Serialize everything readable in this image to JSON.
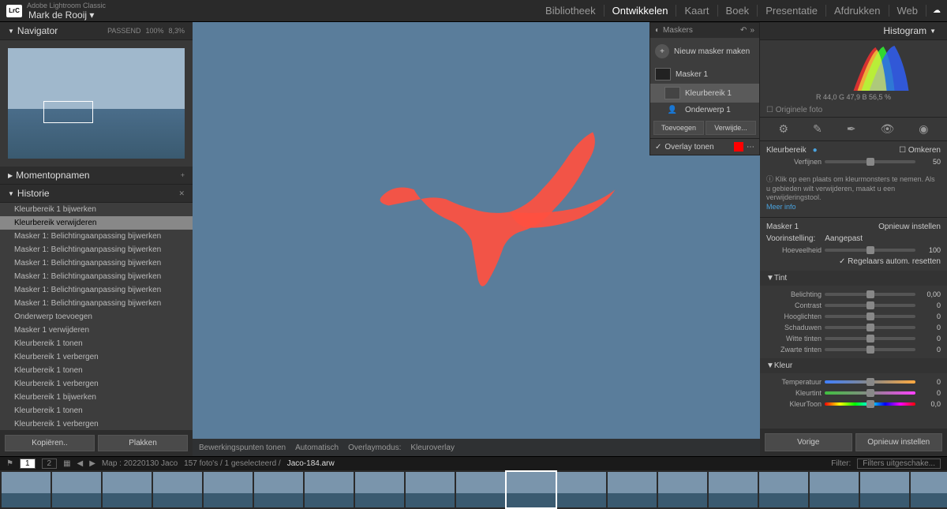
{
  "app": {
    "title_small": "Adobe Lightroom Classic",
    "user": "Mark de Rooij"
  },
  "topnav": {
    "items": [
      "Bibliotheek",
      "Ontwikkelen",
      "Kaart",
      "Boek",
      "Presentatie",
      "Afdrukken",
      "Web"
    ],
    "active": 1
  },
  "navigator": {
    "title": "Navigator",
    "fit": "PASSEND",
    "zoom1": "100%",
    "zoom2": "8,3%"
  },
  "snapshots": {
    "title": "Momentopnamen"
  },
  "history": {
    "title": "Historie",
    "items": [
      "Kleurbereik 1 bijwerken",
      "Kleurbereik verwijderen",
      "Masker 1: Belichtingaanpassing bijwerken",
      "Masker 1: Belichtingaanpassing bijwerken",
      "Masker 1: Belichtingaanpassing bijwerken",
      "Masker 1: Belichtingaanpassing bijwerken",
      "Masker 1: Belichtingaanpassing bijwerken",
      "Masker 1: Belichtingaanpassing bijwerken",
      "Onderwerp toevoegen",
      "Masker 1 verwijderen",
      "Kleurbereik 1 tonen",
      "Kleurbereik 1 verbergen",
      "Kleurbereik 1 tonen",
      "Kleurbereik 1 verbergen",
      "Kleurbereik 1 bijwerken",
      "Kleurbereik 1 tonen",
      "Kleurbereik 1 verbergen"
    ],
    "selected": 1
  },
  "left_buttons": {
    "copy": "Kopiëren..",
    "paste": "Plakken"
  },
  "center_bar": {
    "edit_points": "Bewerkingspunten tonen",
    "auto": "Automatisch",
    "overlay_mode": "Overlaymodus:",
    "overlay_val": "Kleuroverlay"
  },
  "masks": {
    "title": "Maskers",
    "new": "Nieuw masker maken",
    "m1": "Masker 1",
    "k1": "Kleurbereik 1",
    "o1": "Onderwerp 1",
    "add": "Toevoegen",
    "remove": "Verwijde...",
    "overlay": "Overlay tonen"
  },
  "histogram": {
    "title": "Histogram",
    "rgb": "R   44,0  G   47,9  B   56,5 %",
    "orig": "Originele foto"
  },
  "range": {
    "title": "Kleurbereik",
    "invert": "Omkeren",
    "refine": "Verfijnen",
    "refine_val": "50",
    "info": "Klik op een plaats om kleurmonsters te nemen. Als u gebieden wilt verwijderen, maakt u een verwijderingstool.",
    "more": "Meer info"
  },
  "mask_adj": {
    "name": "Masker 1",
    "reset": "Opnieuw instellen",
    "preset_lbl": "Voorinstelling:",
    "preset_val": "Aangepast",
    "amount_lbl": "Hoeveelheid",
    "amount_val": "100",
    "auto_reset": "Regelaars autom. resetten"
  },
  "tint_sect": {
    "title": "Tint",
    "rows": [
      {
        "lbl": "Belichting",
        "val": "0,00"
      },
      {
        "lbl": "Contrast",
        "val": "0"
      },
      {
        "lbl": "Hooglichten",
        "val": "0"
      },
      {
        "lbl": "Schaduwen",
        "val": "0"
      },
      {
        "lbl": "Witte tinten",
        "val": "0"
      },
      {
        "lbl": "Zwarte tinten",
        "val": "0"
      }
    ]
  },
  "color_sect": {
    "title": "Kleur",
    "rows": [
      {
        "lbl": "Temperatuur",
        "val": "0"
      },
      {
        "lbl": "Kleurtint",
        "val": "0"
      },
      {
        "lbl": "KleurToon",
        "val": "0,0"
      }
    ]
  },
  "right_buttons": {
    "prev": "Vorige",
    "reset": "Opnieuw instellen"
  },
  "filmstrip": {
    "folder": "Map : 20220130 Jaco",
    "count": "157 foto's / 1 geselecteerd /",
    "file": "Jaco-184.arw",
    "filter": "Filter:",
    "filter_val": "Filters uitgeschake...",
    "start": 75,
    "selected": 85
  }
}
